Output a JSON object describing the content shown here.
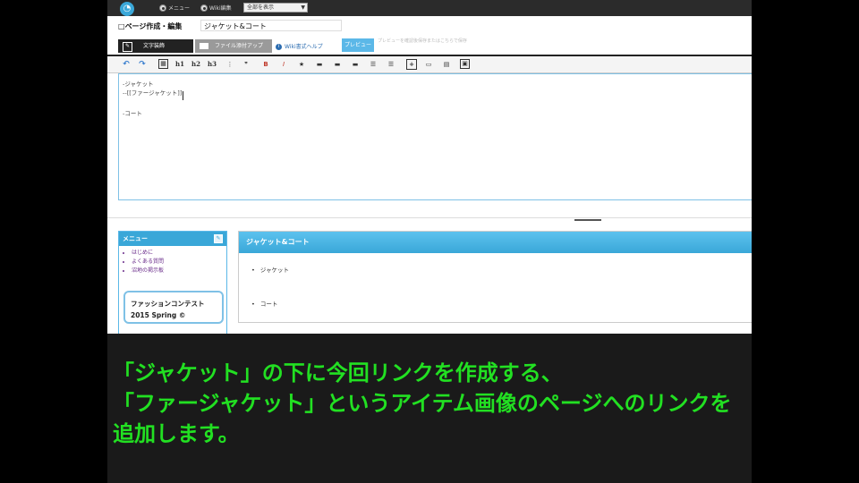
{
  "topbar": {
    "radio_menu_label": "メニュー",
    "radio_wiki_label": "Wiki編集",
    "select_value": "全部を表示"
  },
  "title": {
    "label": "ページ作成・編集",
    "page_name": "ジャケット&コート"
  },
  "tabs": {
    "text_edit": "文字装飾",
    "image_upload": "ファイル添付アップ",
    "help": "Wiki書式ヘルプ",
    "preview_button": "プレビュー",
    "preview_hint": "プレビューを確認後保存またはこちらで保存"
  },
  "toolbar": {
    "h1": "h1",
    "h2": "h2",
    "h3": "h3",
    "bold": "B",
    "italic": "I"
  },
  "editor": {
    "lines": [
      "-ジャケット",
      "--[[ファージャケット]]",
      "-コート"
    ]
  },
  "menu": {
    "title": "メニュー",
    "items": [
      "はじめに",
      "よくある質問",
      "沼地の掲示板"
    ],
    "banner": "ファッションコンテスト 2015 Spring ©"
  },
  "content": {
    "title": "ジャケット&コート",
    "items": [
      "ジャケット",
      "コート"
    ]
  },
  "subtitle": {
    "lines": [
      "「ジャケット」の下に今回リンクを作成する、",
      "「ファージャケット」というアイテム画像のページへのリンクを",
      "追加します。"
    ]
  }
}
